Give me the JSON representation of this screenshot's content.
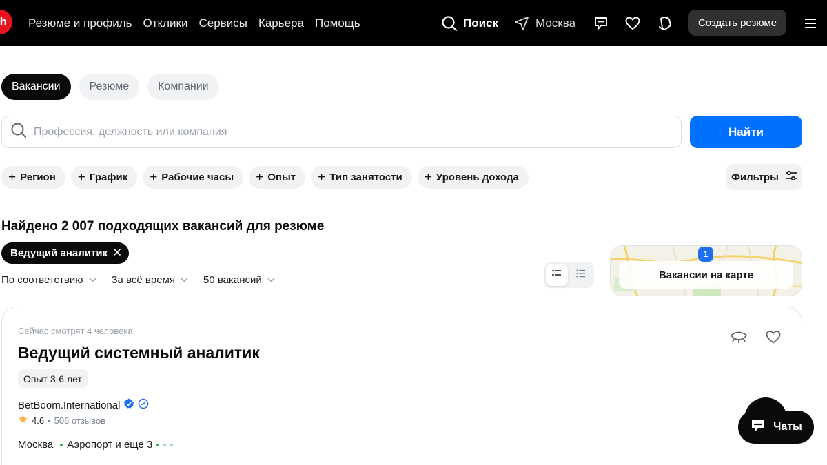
{
  "nav": {
    "logo_text": "h",
    "links": [
      "Резюме и профиль",
      "Отклики",
      "Сервисы",
      "Карьера",
      "Помощь"
    ],
    "search_label": "Поиск",
    "city_label": "Москва",
    "create_resume_label": "Создать резюме"
  },
  "tabs": [
    {
      "label": "Вакансии",
      "active": true
    },
    {
      "label": "Резюме",
      "active": false
    },
    {
      "label": "Компании",
      "active": false
    }
  ],
  "search": {
    "placeholder": "Профессия, должность или компания",
    "value": "",
    "button_label": "Найти"
  },
  "chips": [
    "Регион",
    "График",
    "Рабочие часы",
    "Опыт",
    "Тип занятости",
    "Уровень дохода"
  ],
  "filters_label": "Фильтры",
  "results": {
    "found_text": "Найдено 2 007 подходящих вакансий для резюме",
    "query_chip": "Ведущий аналитик",
    "sort_relevance": "По соответствию",
    "sort_period": "За всё время",
    "per_page": "50 вакансий"
  },
  "map": {
    "label": "Вакансии на карте",
    "pin_count": "1"
  },
  "vacancy": {
    "watching": "Сейчас смотрят 4 человека",
    "title": "Ведущий системный аналитик",
    "experience": "Опыт 3-6 лет",
    "company": "BetBoom.International",
    "rating": "4.6",
    "reviews": "506 отзывов",
    "city": "Москва",
    "metro": "Аэропорт и еще 3"
  },
  "chats_label": "Чаты",
  "colors": {
    "brand_red": "#e6141e",
    "primary_blue": "#0070ff",
    "header_bg": "#000000",
    "chip_bg": "#f1f2f4",
    "metro_green": "#2bb24c"
  }
}
